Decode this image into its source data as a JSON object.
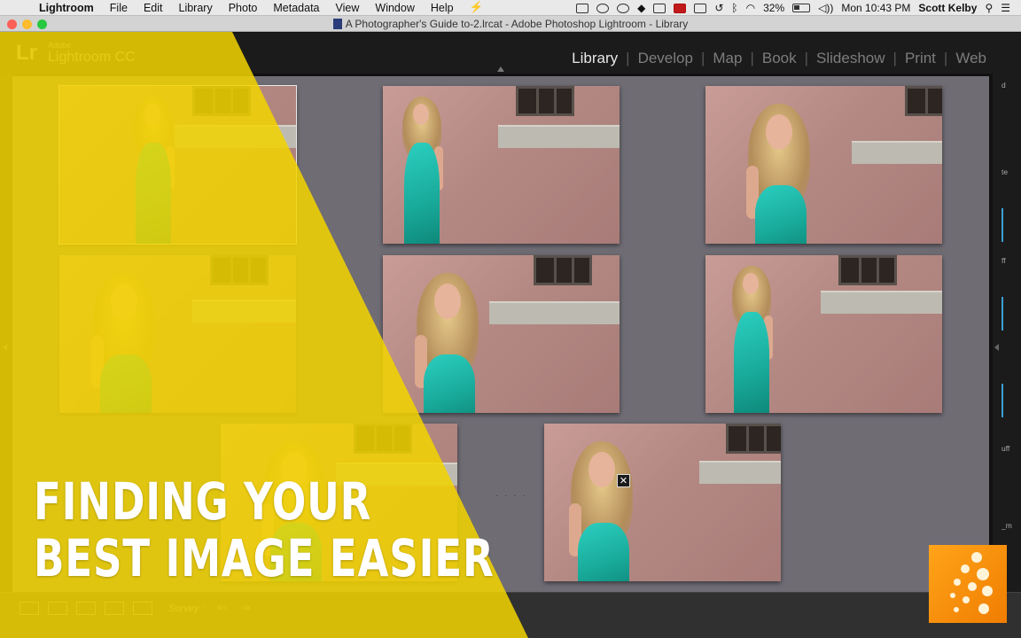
{
  "menubar": {
    "app_name": "Lightroom",
    "items": [
      "File",
      "Edit",
      "Library",
      "Photo",
      "Metadata",
      "View",
      "Window",
      "Help"
    ],
    "battery": "32%",
    "clock": "Mon 10:43 PM",
    "user": "Scott Kelby"
  },
  "window": {
    "title": "A Photographer's Guide to-2.lrcat - Adobe Photoshop Lightroom - Library"
  },
  "lightroom": {
    "logo_mark": "Lr",
    "logo_small": "Adobe",
    "logo_big": "Lightroom CC",
    "modules": [
      "Library",
      "Develop",
      "Map",
      "Book",
      "Slideshow",
      "Print",
      "Web"
    ],
    "active_module": "Library"
  },
  "right_panel": {
    "fragments": [
      "d",
      "te",
      "ff",
      "uff",
      "_m"
    ]
  },
  "toolbar": {
    "survey_label": "Survey :",
    "arrows": "⇐ ⇒"
  },
  "overlay": {
    "headline_line1": "FINDING YOUR",
    "headline_line2": "BEST IMAGE EASIER",
    "color": "#f2d400"
  },
  "grid": {
    "close_glyph": "✕",
    "photos": [
      {
        "id": "photo-1",
        "selected": true
      },
      {
        "id": "photo-2"
      },
      {
        "id": "photo-3"
      },
      {
        "id": "photo-4"
      },
      {
        "id": "photo-5"
      },
      {
        "id": "photo-6"
      },
      {
        "id": "photo-7"
      },
      {
        "id": "photo-8"
      }
    ]
  }
}
